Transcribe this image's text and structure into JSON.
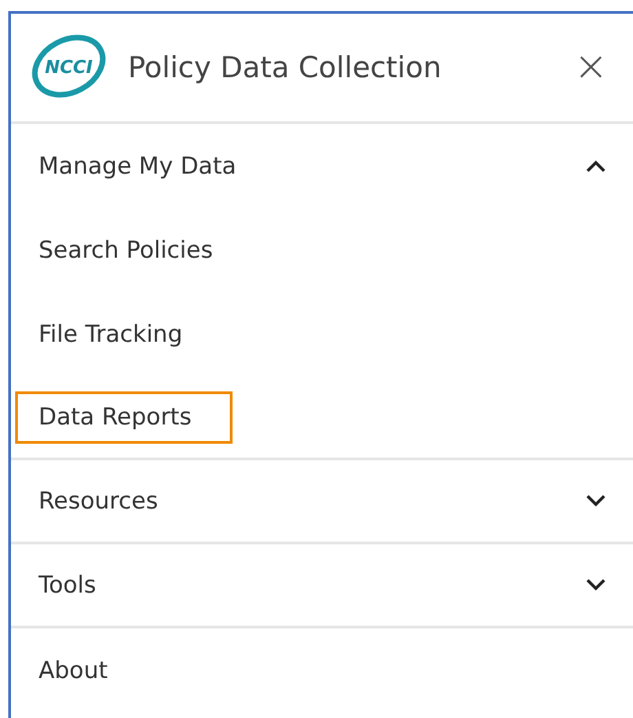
{
  "header": {
    "logo_text": "NCCI",
    "title": "Policy Data Collection",
    "close": "×"
  },
  "menu": [
    {
      "label": "Manage My Data",
      "kind": "group",
      "expanded": true,
      "children": [
        {
          "label": "Search Policies",
          "selected": false
        },
        {
          "label": "File Tracking",
          "selected": false
        },
        {
          "label": "Data Reports",
          "selected": true
        }
      ]
    },
    {
      "label": "Resources",
      "kind": "group",
      "expanded": false
    },
    {
      "label": "Tools",
      "kind": "group",
      "expanded": false
    },
    {
      "label": "About",
      "kind": "link"
    }
  ]
}
